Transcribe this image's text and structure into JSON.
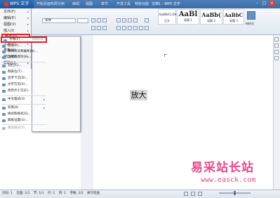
{
  "titlebar": {
    "app_button": "WPS 文字",
    "tabs": [
      "开始",
      "页面布局",
      "引用",
      "审阅",
      "视图",
      "章节",
      "开发工具",
      "特色功能"
    ],
    "doc_title": "文档1 - WPS 文字",
    "window_controls": [
      "–",
      "□",
      "×"
    ]
  },
  "ribbon": {
    "font_name": "宋体",
    "styles": [
      {
        "preview": "AaBbCcDd",
        "label": "正文"
      },
      {
        "preview": "AaBl",
        "label": "标题 1"
      },
      {
        "preview": "AaBb(",
        "label": "标题 2"
      },
      {
        "preview": "AaBbC",
        "label": "标题 3"
      }
    ],
    "new_style_label": "新样式"
  },
  "left_menu": {
    "items": [
      {
        "label": "文件(F)",
        "has_arrow": true
      },
      {
        "label": "编辑(E)",
        "has_arrow": true
      },
      {
        "label": "视图(V)",
        "has_arrow": true
      },
      {
        "label": "插入(I)",
        "has_arrow": true
      },
      {
        "label": "格式(O)",
        "has_arrow": true,
        "highlighted": true
      },
      {
        "label": "工具(T)",
        "has_arrow": true
      },
      {
        "label": "表格(A)",
        "has_arrow": true
      },
      {
        "label": "窗口(W)",
        "has_arrow": true
      },
      {
        "label": "帮助(H)",
        "has_arrow": true
      }
    ]
  },
  "submenu": {
    "items": [
      {
        "label": "字体(F)...",
        "shortcut": "Ctrl+D",
        "highlighted": true
      },
      {
        "label": "段落(P)..."
      },
      {
        "label": "项目符号和编号(N)..."
      },
      {
        "label": "边框和底纹(B)..."
      },
      {
        "label": "分栏(C)..."
      },
      {
        "label": "制表位(T)..."
      },
      {
        "label": "首字下沉(D)..."
      },
      {
        "label": "文字方向(X)..."
      },
      {
        "label": "更改大小写(E)..."
      },
      {
        "label": "中文版式(U)",
        "has_arrow": true
      },
      {
        "label": "背景(K)",
        "has_arrow": true
      },
      {
        "label": "样式和格式(S)..."
      },
      {
        "label": "稿纸设置(G)..."
      },
      {
        "label": "重排样式(R)...",
        "disabled": true
      }
    ]
  },
  "document": {
    "selected_text": "放大"
  },
  "statusbar": {
    "items": [
      "页码: 1",
      "页面: 1/1",
      "节: 1/1",
      "行: 1",
      "列: 1",
      "字数: 2/2",
      "拼写检查"
    ]
  },
  "watermark": {
    "title": "易采站长站",
    "url": "www.easck.com"
  },
  "colors": {
    "highlight_border": "#d8242b",
    "watermark": "#e64a8b",
    "titlebar": "#3b6aa6"
  }
}
